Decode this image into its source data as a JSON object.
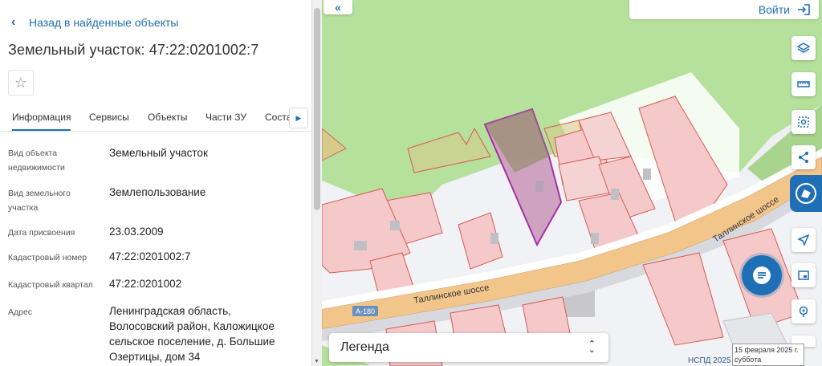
{
  "panel": {
    "back_link": "Назад в найденные объекты",
    "title": "Земельный участок: 47:22:0201002:7",
    "tabs": [
      {
        "label": "Информация"
      },
      {
        "label": "Сервисы"
      },
      {
        "label": "Объекты"
      },
      {
        "label": "Части ЗУ"
      },
      {
        "label": "Соста"
      }
    ],
    "rows": [
      {
        "label": "Вид объекта недвижимости",
        "value": "Земельный участок"
      },
      {
        "label": "Вид земельного участка",
        "value": "Землепользование"
      },
      {
        "label": "Дата присвоения",
        "value": "23.03.2009"
      },
      {
        "label": "Кадастровый номер",
        "value": "47:22:0201002:7"
      },
      {
        "label": "Кадастровый квартал",
        "value": "47:22:0201002"
      },
      {
        "label": "Адрес",
        "value": "Ленинградская область, Волосовский район, Каложицкое сельское поселение, д. Большие Озертицы, дом 34"
      }
    ]
  },
  "map": {
    "login_label": "Войти",
    "road_name_1": "Таллинское шоссе",
    "road_name_2": "Таллинское шоссе",
    "road_badge": "А-180",
    "legend_label": "Легенда",
    "attribution": "НСПД 2025",
    "date_tooltip_line1": "15 февраля 2025 г.",
    "date_tooltip_line2": "суббота",
    "tools": [
      {
        "icon": "layers-icon"
      },
      {
        "icon": "ruler-icon"
      },
      {
        "icon": "area-select-icon"
      },
      {
        "icon": "share-icon"
      },
      {
        "icon": "brand-logo-icon"
      },
      {
        "icon": "location-arrow-icon"
      },
      {
        "icon": "minimap-icon"
      },
      {
        "icon": "pin-search-icon"
      }
    ]
  },
  "colors": {
    "accent": "#1e6fb5",
    "forest": "#aedd93",
    "plot_highlight": "#a630a8",
    "road": "#f2c58a"
  }
}
